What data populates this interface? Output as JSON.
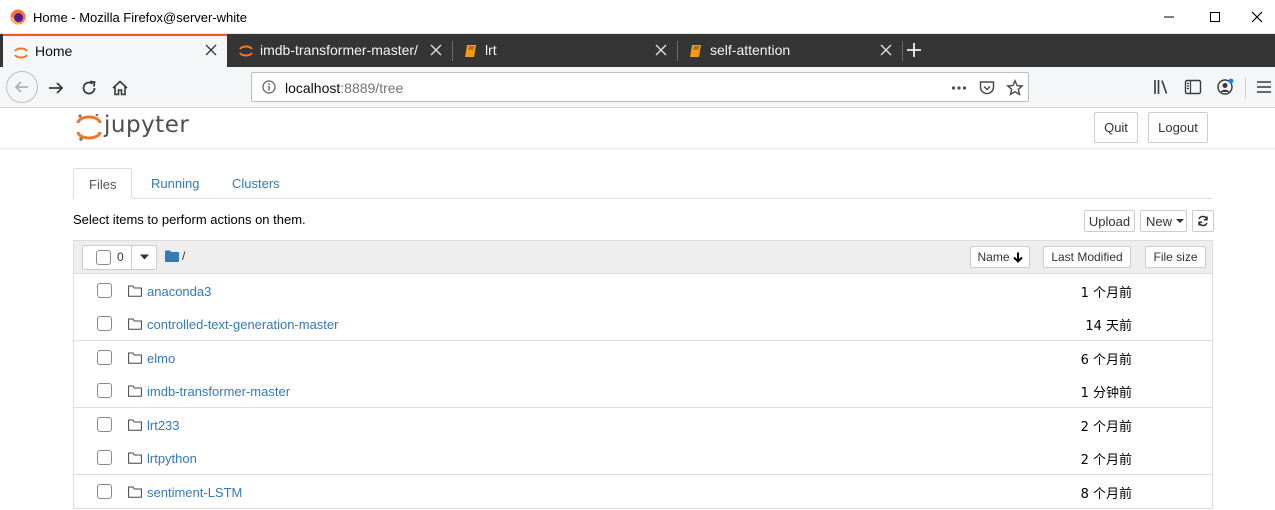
{
  "window": {
    "title": "Home - Mozilla Firefox@server-white"
  },
  "tabs": [
    {
      "label": "Home",
      "active": true,
      "icon": "jupyter-icon"
    },
    {
      "label": "imdb-transformer-master/",
      "active": false,
      "icon": "jupyter-icon"
    },
    {
      "label": "lrt",
      "active": false,
      "icon": "notebook-icon"
    },
    {
      "label": "self-attention",
      "active": false,
      "icon": "notebook-icon"
    }
  ],
  "urlbar": {
    "host": "localhost",
    "rest": ":8889/tree"
  },
  "jupyter": {
    "logo_text": "jupyter",
    "quit_label": "Quit",
    "logout_label": "Logout"
  },
  "page_tabs": {
    "files": "Files",
    "running": "Running",
    "clusters": "Clusters"
  },
  "hint": "Select items to perform actions on them.",
  "actions": {
    "upload": "Upload",
    "new": "New"
  },
  "list_header": {
    "selected_count": "0",
    "path": "/",
    "name_col": "Name",
    "modified_col": "Last Modified",
    "size_col": "File size"
  },
  "files": [
    {
      "name": "anaconda3",
      "modified": "1 个月前"
    },
    {
      "name": "controlled-text-generation-master",
      "modified": "14 天前"
    },
    {
      "name": "elmo",
      "modified": "6 个月前"
    },
    {
      "name": "imdb-transformer-master",
      "modified": "1 分钟前"
    },
    {
      "name": "lrt233",
      "modified": "2 个月前"
    },
    {
      "name": "lrtpython",
      "modified": "2 个月前"
    },
    {
      "name": "sentiment-LSTM",
      "modified": "8 个月前"
    }
  ],
  "colors": {
    "tab_bar": "#353535",
    "firefox_accent": "#ee5a25",
    "link": "#337ab7",
    "jupyter_orange": "#f37726"
  }
}
